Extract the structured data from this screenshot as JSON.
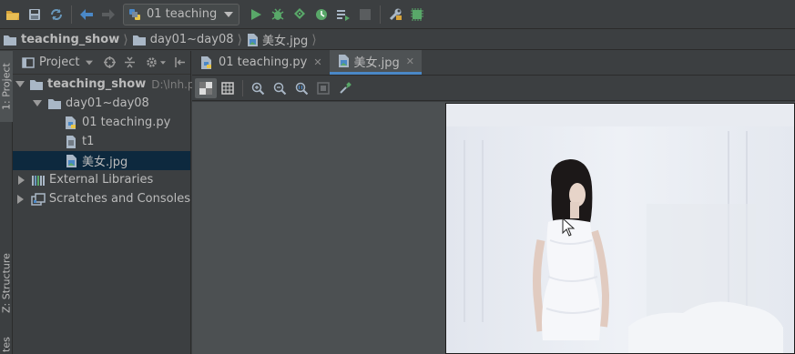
{
  "toolbar": {
    "run_config_label": "01 teaching"
  },
  "breadcrumb": {
    "items": [
      "teaching_show",
      "day01~day08",
      "美女.jpg"
    ]
  },
  "side_strip": {
    "project_tab": "1: Project",
    "structure_tab": "Z: Structure",
    "favorites_tab": "tes"
  },
  "project_panel": {
    "title": "Project",
    "tree": {
      "root_name": "teaching_show",
      "root_path": "D:\\lnh.pyth",
      "folder": "day01~day08",
      "files": [
        "01 teaching.py",
        "t1",
        "美女.jpg"
      ],
      "external_libraries": "External Libraries",
      "scratches": "Scratches and Consoles"
    }
  },
  "editor_tabs": {
    "tabs": [
      "01 teaching.py",
      "美女.jpg"
    ],
    "close_glyph": "✕"
  },
  "colors": {
    "bg": "#3c3f41",
    "selection": "#0d293e",
    "accent": "#4a88c7",
    "run_green": "#59a869"
  }
}
